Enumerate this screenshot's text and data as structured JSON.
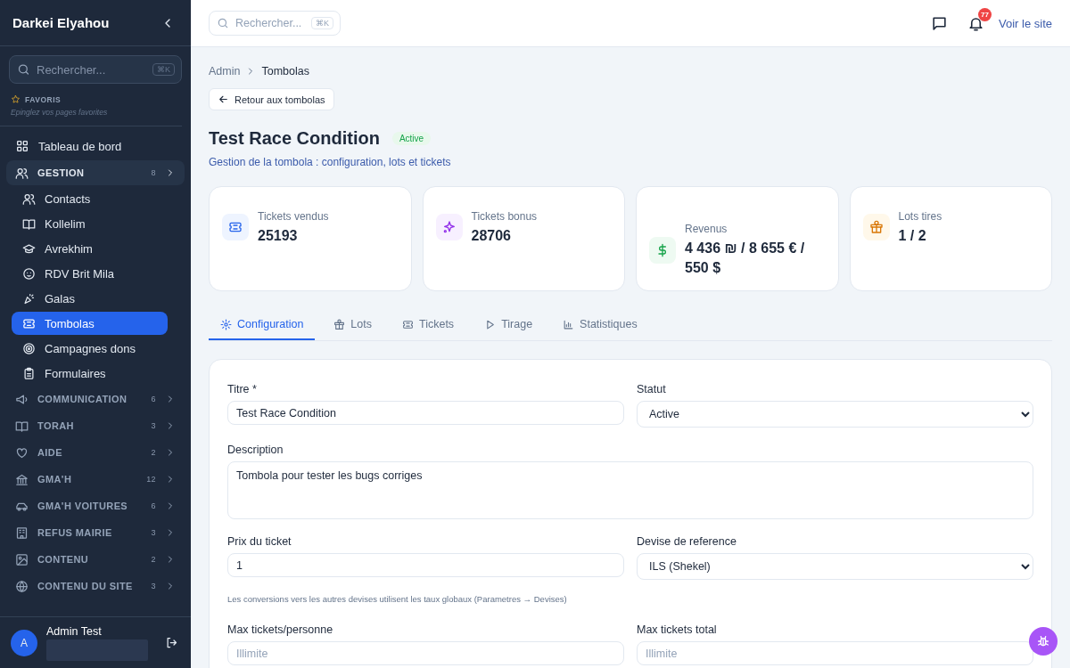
{
  "sidebar": {
    "brand": "Darkei Elyahou",
    "search": {
      "placeholder": "Rechercher...",
      "shortcut": "⌘K"
    },
    "favorites": {
      "title": "FAVORIS",
      "hint": "Epinglez vos pages favorites"
    },
    "items": [
      {
        "kind": "link",
        "label": "Tableau de bord",
        "selected": false
      },
      {
        "kind": "section",
        "label": "GESTION",
        "count": "8",
        "expanded": true,
        "children": [
          {
            "label": "Contacts",
            "selected": false
          },
          {
            "label": "Kollelim",
            "selected": false
          },
          {
            "label": "Avrekhim",
            "selected": false
          },
          {
            "label": "RDV Brit Mila",
            "selected": false
          },
          {
            "label": "Galas",
            "selected": false
          },
          {
            "label": "Tombolas",
            "selected": true
          },
          {
            "label": "Campagnes dons",
            "selected": false
          },
          {
            "label": "Formulaires",
            "selected": false
          }
        ]
      },
      {
        "kind": "section",
        "label": "COMMUNICATION",
        "count": "6",
        "expanded": false
      },
      {
        "kind": "section",
        "label": "TORAH",
        "count": "3",
        "expanded": false
      },
      {
        "kind": "section",
        "label": "AIDE",
        "count": "2",
        "expanded": false
      },
      {
        "kind": "section",
        "label": "GMA'H",
        "count": "12",
        "expanded": false
      },
      {
        "kind": "section",
        "label": "GMA'H VOITURES",
        "count": "6",
        "expanded": false
      },
      {
        "kind": "section",
        "label": "REFUS MAIRIE",
        "count": "3",
        "expanded": false
      },
      {
        "kind": "section",
        "label": "CONTENU",
        "count": "2",
        "expanded": false
      },
      {
        "kind": "section",
        "label": "CONTENU DU SITE",
        "count": "3",
        "expanded": false
      }
    ],
    "user": {
      "avatar": "A",
      "name": "Admin Test"
    }
  },
  "topbar": {
    "search": {
      "placeholder": "Rechercher...",
      "shortcut": "⌘K"
    },
    "notifications": "77",
    "site_link": "Voir le site"
  },
  "breadcrumb": [
    "Admin",
    "Tombolas"
  ],
  "back_button": "Retour aux tombolas",
  "title": "Test Race Condition",
  "status": "Active",
  "subtitle": "Gestion de la tombola : configuration, lots et tickets",
  "stats": [
    {
      "label": "Tickets vendus",
      "value": "25193"
    },
    {
      "label": "Tickets bonus",
      "value": "28706"
    },
    {
      "label": "Revenus",
      "value": "4 436 ₪ / 8 655 € / 550 $"
    },
    {
      "label": "Lots tires",
      "value": "1 / 2"
    }
  ],
  "tabs": [
    {
      "label": "Configuration",
      "selected": true
    },
    {
      "label": "Lots",
      "selected": false
    },
    {
      "label": "Tickets",
      "selected": false
    },
    {
      "label": "Tirage",
      "selected": false
    },
    {
      "label": "Statistiques",
      "selected": false
    }
  ],
  "form": [
    {
      "kind": "input",
      "label": "Titre *",
      "value": "Test Race Condition"
    },
    {
      "kind": "select",
      "label": "Statut",
      "value": "Active"
    },
    {
      "kind": "textarea",
      "label": "Description",
      "value": "Tombola pour tester les bugs corriges"
    },
    {
      "kind": "input",
      "label": "Prix du ticket",
      "value": "1"
    },
    {
      "kind": "select",
      "label": "Devise de reference",
      "value": "ILS (Shekel)"
    },
    {
      "kind": "hint",
      "text": "Les conversions vers les autres devises utilisent les taux globaux (Parametres → Devises)"
    },
    {
      "kind": "input",
      "label": "Max tickets/personne",
      "placeholder": "Illimite"
    },
    {
      "kind": "input",
      "label": "Max tickets total",
      "placeholder": "Illimite"
    }
  ]
}
